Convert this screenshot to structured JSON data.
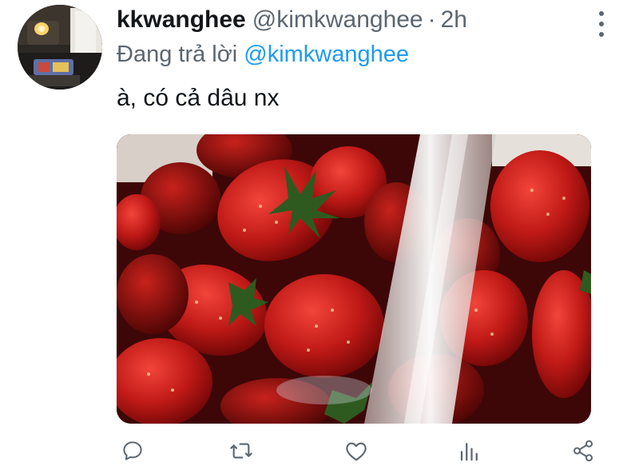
{
  "tweet": {
    "display_name": "kkwanghee",
    "handle": "@kimkwanghee",
    "separator": "·",
    "time": "2h",
    "reply_prefix": "Đang trả lời",
    "reply_to": "@kimkwanghee",
    "text": "à, có cả dâu nx"
  },
  "media": {
    "description_icon": "photo-strawberries-water"
  },
  "actions": [
    "reply-icon",
    "retweet-icon",
    "like-icon",
    "analytics-icon",
    "share-icon"
  ],
  "colors": {
    "accent": "#1d9bf0",
    "secondary_text": "#5b6670",
    "icon": "#5b6670"
  }
}
